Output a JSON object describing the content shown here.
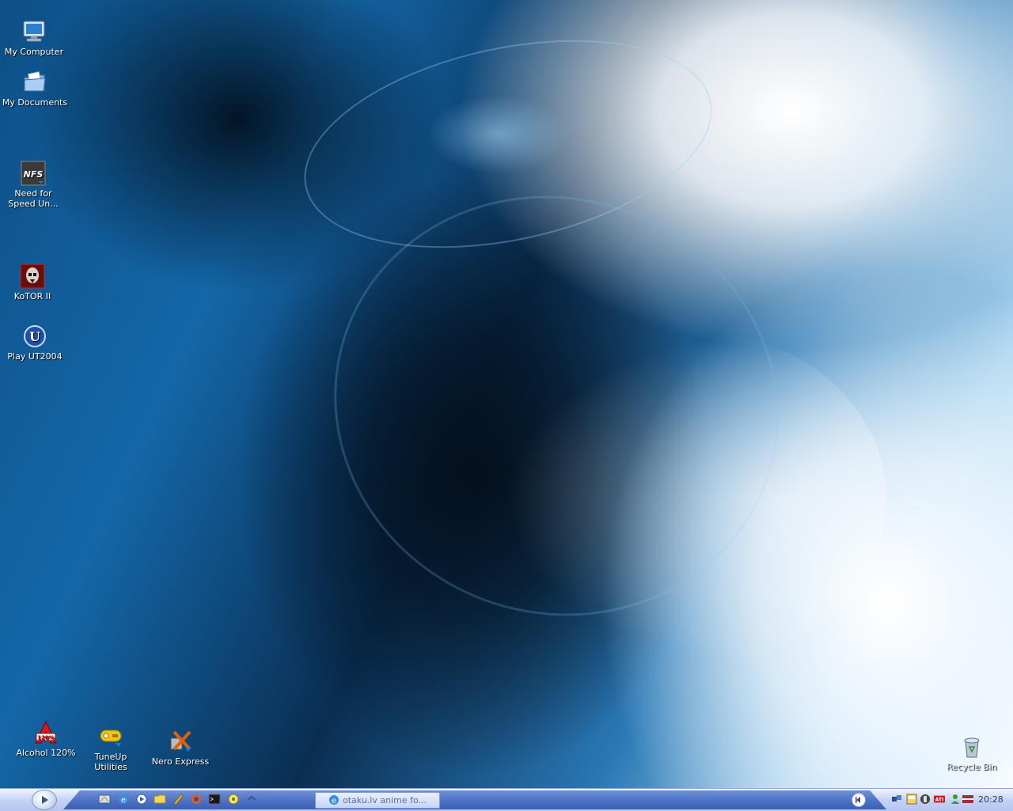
{
  "desktop": {
    "icons": {
      "my_computer": "My Computer",
      "my_documents": "My Documents",
      "nfs_line1": "Need for",
      "nfs_line2": "Speed Un...",
      "kotor": "KoTOR II",
      "ut2004": "Play UT2004",
      "alcohol": "Alcohol 120%",
      "tuneup_line1": "TuneUp",
      "tuneup_line2": "Utilities",
      "nero": "Nero Express",
      "recycle": "Recycle Bin"
    },
    "icon_badges": {
      "nfs": "NFS",
      "alcohol": "120%",
      "ut": "U"
    }
  },
  "taskbar": {
    "start_icon": "play-icon",
    "quick_launch": [
      "show-desktop-icon",
      "internet-explorer-icon",
      "media-player-icon",
      "folder-icon",
      "pencil-icon",
      "firefox-icon",
      "terminal-icon",
      "messenger-icon",
      "chevron-icon"
    ],
    "task_button": "otaku.lv anime fo...",
    "tray_icons": [
      "network-icon",
      "security-icon",
      "hardware-icon",
      "ati-icon",
      "messenger-status-icon",
      "latvian-flag-icon"
    ],
    "clock": "20:28"
  },
  "colors": {
    "taskbar_bar": "#4a6fc4",
    "taskbar_bg": "#c5d3f6",
    "wallpaper_dark": "#0a2e52",
    "wallpaper_light": "#ffffff"
  }
}
